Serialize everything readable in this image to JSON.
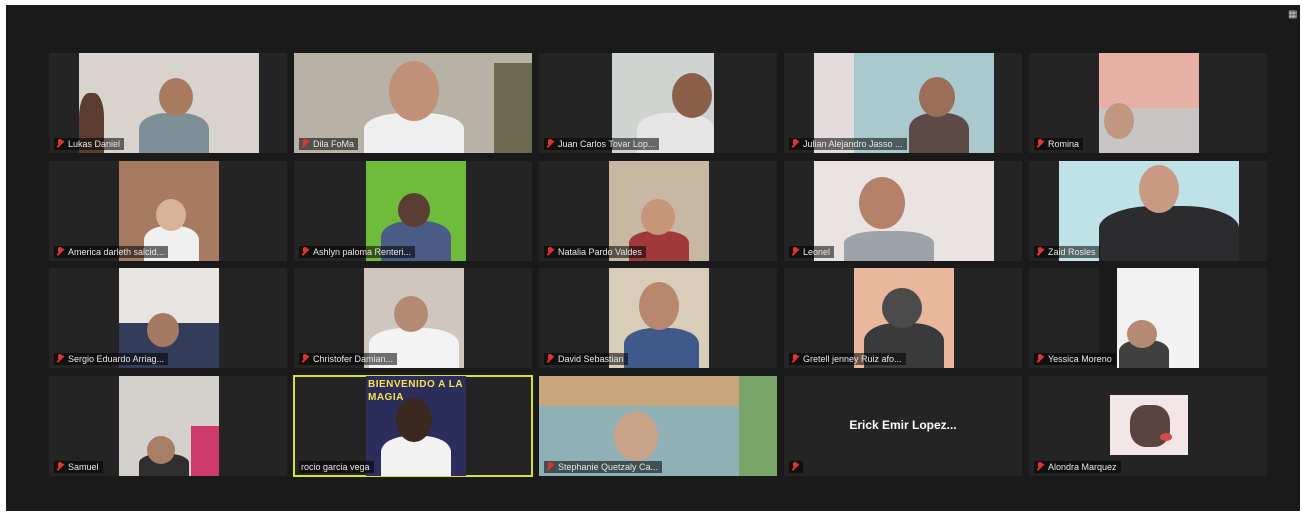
{
  "app": {
    "view_icon": "gallery-view-icon"
  },
  "colors": {
    "background": "#1a1a1a",
    "tile": "#242424",
    "active_border": "#d6e23a",
    "mic_muted": "#e0352b"
  },
  "participants": [
    {
      "name": "Lukas Daniel",
      "muted": true
    },
    {
      "name": "Dila FoMa",
      "muted": true
    },
    {
      "name": "Juan Carlos Tovar Lop...",
      "muted": true
    },
    {
      "name": "Julian Alejandro Jasso ...",
      "muted": true
    },
    {
      "name": "Romina",
      "muted": true
    },
    {
      "name": "America darleth salcid...",
      "muted": true
    },
    {
      "name": "Ashlyn paloma Renteri...",
      "muted": true
    },
    {
      "name": "Natalia Pardo Valdes",
      "muted": true
    },
    {
      "name": "Leonel",
      "muted": true
    },
    {
      "name": "Zaid Rosles",
      "muted": true
    },
    {
      "name": "Sergio Eduardo Arriag...",
      "muted": true
    },
    {
      "name": "Christofer Damian...",
      "muted": true
    },
    {
      "name": "David Sebastian",
      "muted": true
    },
    {
      "name": "Gretell jenney Ruiz afo...",
      "muted": true
    },
    {
      "name": "Yessica Moreno",
      "muted": true
    },
    {
      "name": "Samuel",
      "muted": true
    },
    {
      "name": "rocio garcia vega",
      "muted": false,
      "active_speaker": true
    },
    {
      "name": "Stephanie Quetzaly Ca...",
      "muted": true
    },
    {
      "name": "",
      "display_name": "Erick Emir Lopez...",
      "muted": true,
      "video_off": true
    },
    {
      "name": "Alondra Marquez",
      "muted": true
    }
  ],
  "banner_text": "BIENVENIDO A LA MAGIA"
}
